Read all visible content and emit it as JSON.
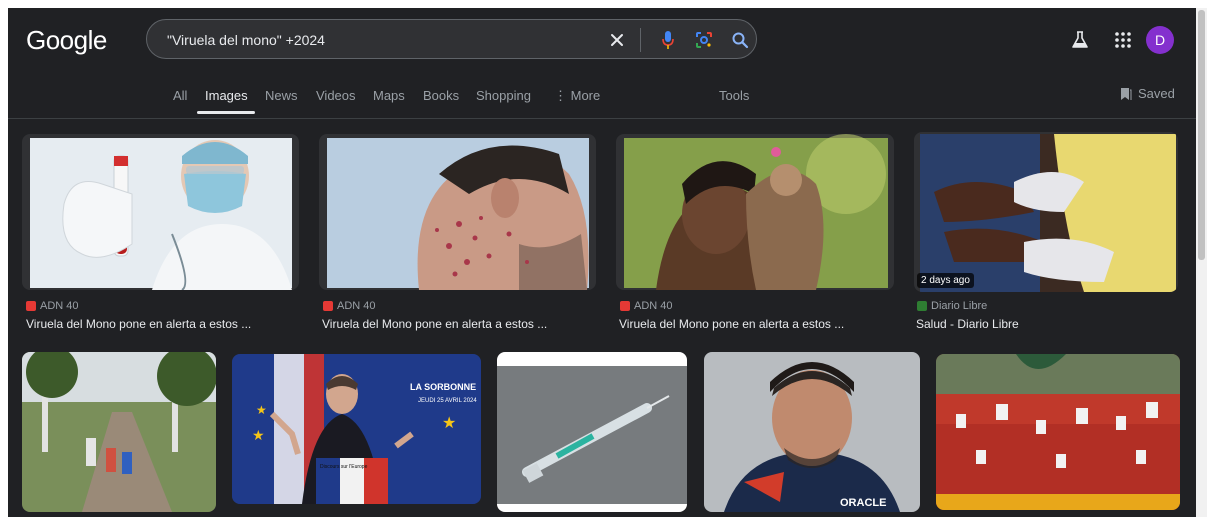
{
  "header": {
    "logo": "Google",
    "search_value": "\"Viruela del mono\" +2024",
    "avatar_letter": "D"
  },
  "tabs": [
    {
      "label": "All",
      "active": false
    },
    {
      "label": "Images",
      "active": true
    },
    {
      "label": "News",
      "active": false
    },
    {
      "label": "Videos",
      "active": false
    },
    {
      "label": "Maps",
      "active": false
    },
    {
      "label": "Books",
      "active": false
    },
    {
      "label": "Shopping",
      "active": false
    },
    {
      "label": "⋮ More",
      "active": false
    }
  ],
  "tools_label": "Tools",
  "saved_label": "Saved",
  "results_row1": [
    {
      "source": "ADN 40",
      "title": "Viruela del Mono pone en alerta a estos ...",
      "favicon_color": "#e53935"
    },
    {
      "source": "ADN 40",
      "title": "Viruela del Mono pone en alerta a estos ...",
      "favicon_color": "#e53935"
    },
    {
      "source": "ADN 40",
      "title": "Viruela del Mono pone en alerta a estos ...",
      "favicon_color": "#e53935"
    },
    {
      "source": "Diario Libre",
      "title": "Salud - Diario Libre",
      "favicon_color": "#2e7d32",
      "badge": "2 days ago"
    }
  ],
  "image_texts": {
    "sorbonne_title": "LA SORBONNE",
    "sorbonne_date": "JEUDI 25 AVRIL 2024",
    "podium_text": "Discours sur l'Europe",
    "oracle_text": "ORACLE"
  },
  "colors": {
    "background": "#202124",
    "accent": "#8ab4f8",
    "avatar": "#8430ce"
  }
}
